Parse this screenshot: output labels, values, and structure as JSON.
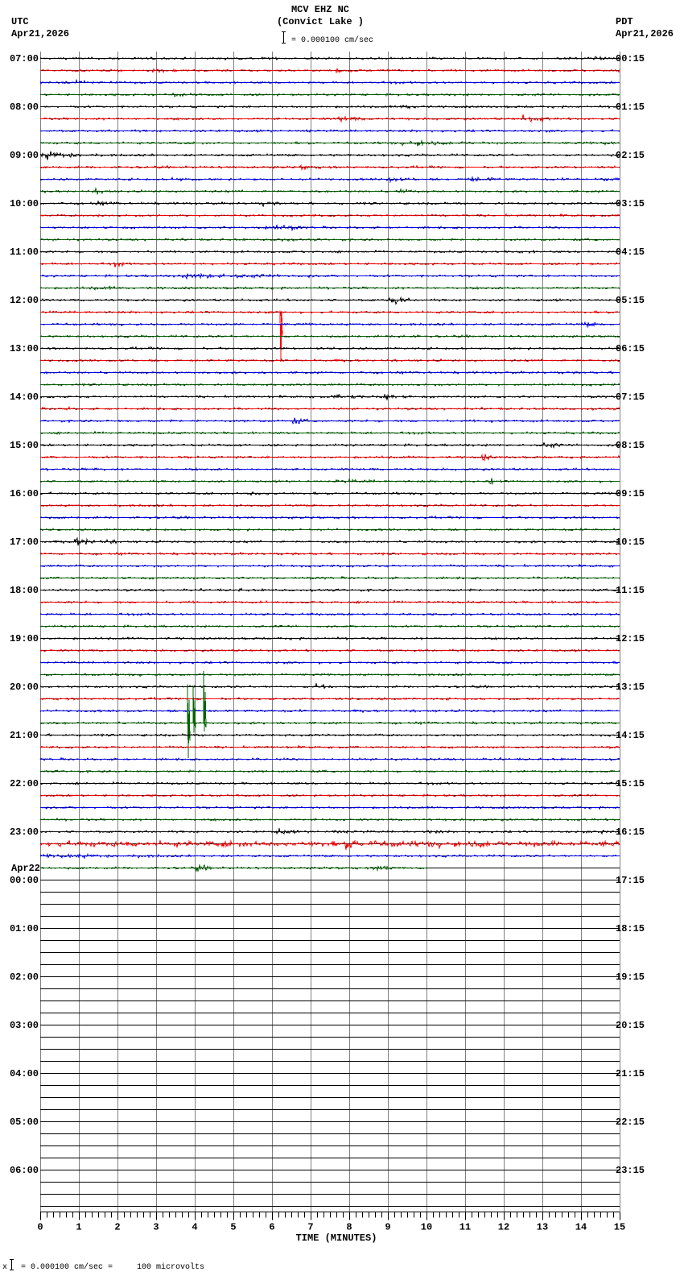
{
  "header": {
    "station": "MCV EHZ NC",
    "location": "(Convict Lake )",
    "left_zone": "UTC",
    "left_date": "Apr21,2026",
    "right_zone": "PDT",
    "right_date": "Apr21,2026",
    "scale_text": "= 0.000100 cm/sec"
  },
  "footer": {
    "prefix": "x",
    "scale_text": "= 0.000100 cm/sec =     100 microvolts"
  },
  "chart_data": {
    "type": "line",
    "title": "MCV EHZ NC (Convict Lake )",
    "xlabel": "TIME (MINUTES)",
    "x_ticks": [
      "0",
      "1",
      "2",
      "3",
      "4",
      "5",
      "6",
      "7",
      "8",
      "9",
      "10",
      "11",
      "12",
      "13",
      "14",
      "15"
    ],
    "xlim": [
      0,
      15
    ],
    "minutes_per_line": 15,
    "lines_per_hour": 4,
    "total_lines": 96,
    "recorded_lines": 68,
    "last_line_end_min": 10.0,
    "trace_colors": [
      "#000000",
      "#ff0000",
      "#0000ff",
      "#006400"
    ],
    "grid_color": "#808080",
    "amplitude_unit_cm_per_sec": 0.0001,
    "noise_level": 0.07,
    "left_labels": [
      "07:00",
      "08:00",
      "09:00",
      "10:00",
      "11:00",
      "12:00",
      "13:00",
      "14:00",
      "15:00",
      "16:00",
      "17:00",
      "18:00",
      "19:00",
      "20:00",
      "21:00",
      "22:00",
      "23:00",
      "00:00",
      "01:00",
      "02:00",
      "03:00",
      "04:00",
      "05:00",
      "06:00"
    ],
    "date_change_label": "Apr22",
    "right_labels": [
      "00:15",
      "01:15",
      "02:15",
      "03:15",
      "04:15",
      "05:15",
      "06:15",
      "07:15",
      "08:15",
      "09:15",
      "10:15",
      "11:15",
      "12:15",
      "13:15",
      "14:15",
      "15:15",
      "16:15",
      "17:15",
      "18:15",
      "19:15",
      "20:15",
      "21:15",
      "22:15",
      "23:15"
    ],
    "events": [
      {
        "line": 0,
        "t": 14.1,
        "dur": 0.6,
        "amp": 0.12
      },
      {
        "line": 1,
        "t": 2.9,
        "dur": 0.6,
        "amp": 0.15
      },
      {
        "line": 1,
        "t": 7.6,
        "dur": 0.7,
        "amp": 0.15
      },
      {
        "line": 1,
        "t": 14.6,
        "dur": 0.4,
        "amp": 0.12
      },
      {
        "line": 2,
        "t": 0.3,
        "dur": 2.0,
        "amp": 0.1
      },
      {
        "line": 3,
        "t": 3.3,
        "dur": 0.8,
        "amp": 0.15
      },
      {
        "line": 4,
        "t": 9.3,
        "dur": 0.8,
        "amp": 0.15
      },
      {
        "line": 5,
        "t": 7.6,
        "dur": 1.0,
        "amp": 0.22
      },
      {
        "line": 5,
        "t": 12.4,
        "dur": 0.9,
        "amp": 0.3
      },
      {
        "line": 6,
        "t": 6.8,
        "dur": 0.6,
        "amp": 0.1
      },
      {
        "line": 7,
        "t": 9.3,
        "dur": 2.2,
        "amp": 0.2
      },
      {
        "line": 7,
        "t": 14.5,
        "dur": 0.5,
        "amp": 0.15
      },
      {
        "line": 8,
        "t": 0.0,
        "dur": 1.5,
        "amp": 0.3
      },
      {
        "line": 9,
        "t": 6.7,
        "dur": 0.7,
        "amp": 0.15
      },
      {
        "line": 10,
        "t": 3.3,
        "dur": 0.8,
        "amp": 0.15
      },
      {
        "line": 10,
        "t": 8.8,
        "dur": 1.0,
        "amp": 0.2
      },
      {
        "line": 10,
        "t": 10.9,
        "dur": 1.2,
        "amp": 0.25
      },
      {
        "line": 10,
        "t": 14.5,
        "dur": 0.4,
        "amp": 0.2
      },
      {
        "line": 11,
        "t": 1.4,
        "dur": 0.5,
        "amp": 0.2
      },
      {
        "line": 11,
        "t": 9.2,
        "dur": 0.6,
        "amp": 0.15
      },
      {
        "line": 12,
        "t": 1.3,
        "dur": 0.7,
        "amp": 0.12
      },
      {
        "line": 12,
        "t": 5.7,
        "dur": 0.6,
        "amp": 0.12
      },
      {
        "line": 13,
        "t": 1.4,
        "dur": 0.3,
        "amp": 0.15
      },
      {
        "line": 14,
        "t": 5.8,
        "dur": 1.0,
        "amp": 0.3
      },
      {
        "line": 15,
        "t": 6.1,
        "dur": 0.4,
        "amp": 0.25
      },
      {
        "line": 16,
        "t": 12.3,
        "dur": 0.5,
        "amp": 0.15
      },
      {
        "line": 17,
        "t": 1.9,
        "dur": 0.4,
        "amp": 0.2
      },
      {
        "line": 18,
        "t": 3.5,
        "dur": 3.5,
        "amp": 0.18
      },
      {
        "line": 19,
        "t": 1.3,
        "dur": 0.8,
        "amp": 0.12
      },
      {
        "line": 20,
        "t": 9.0,
        "dur": 0.6,
        "amp": 0.45
      },
      {
        "line": 22,
        "t": 14.0,
        "dur": 0.6,
        "amp": 0.2
      },
      {
        "line": 23,
        "t": 9.2,
        "dur": 0.6,
        "amp": 0.18
      },
      {
        "line": 28,
        "t": 7.5,
        "dur": 2.2,
        "amp": 0.15
      },
      {
        "line": 28,
        "t": 8.9,
        "dur": 0.5,
        "amp": 0.25
      },
      {
        "line": 29,
        "t": 0.5,
        "dur": 0.3,
        "amp": 0.2
      },
      {
        "line": 30,
        "t": 6.5,
        "dur": 0.5,
        "amp": 0.25
      },
      {
        "line": 30,
        "t": 11.5,
        "dur": 0.3,
        "amp": 0.15
      },
      {
        "line": 32,
        "t": 13.0,
        "dur": 0.5,
        "amp": 0.3
      },
      {
        "line": 33,
        "t": 11.4,
        "dur": 0.4,
        "amp": 0.3
      },
      {
        "line": 34,
        "t": 1.4,
        "dur": 0.3,
        "amp": 0.2
      },
      {
        "line": 35,
        "t": 7.5,
        "dur": 1.5,
        "amp": 0.12
      },
      {
        "line": 35,
        "t": 11.6,
        "dur": 0.4,
        "amp": 0.22
      },
      {
        "line": 36,
        "t": 5.3,
        "dur": 1.2,
        "amp": 0.15
      },
      {
        "line": 40,
        "t": 0.8,
        "dur": 1.2,
        "amp": 0.3
      },
      {
        "line": 44,
        "t": 5.0,
        "dur": 0.5,
        "amp": 0.1
      },
      {
        "line": 52,
        "t": 7.1,
        "dur": 0.5,
        "amp": 0.25
      },
      {
        "line": 64,
        "t": 6.1,
        "dur": 0.6,
        "amp": 0.2
      },
      {
        "line": 64,
        "t": 7.5,
        "dur": 1.0,
        "amp": 0.15
      },
      {
        "line": 64,
        "t": 10.0,
        "dur": 0.5,
        "amp": 0.15
      },
      {
        "line": 64,
        "t": 14.5,
        "dur": 0.5,
        "amp": 0.3
      },
      {
        "line": 65,
        "t": 0.0,
        "dur": 15.0,
        "amp": 0.12
      },
      {
        "line": 65,
        "t": 7.8,
        "dur": 1.2,
        "amp": 0.25
      },
      {
        "line": 65,
        "t": 11.2,
        "dur": 0.6,
        "amp": 0.2
      },
      {
        "line": 66,
        "t": 0.0,
        "dur": 3.5,
        "amp": 0.12
      },
      {
        "line": 67,
        "t": 4.0,
        "dur": 0.5,
        "amp": 0.25
      },
      {
        "line": 67,
        "t": 8.6,
        "dur": 0.8,
        "amp": 0.2
      }
    ],
    "spikes": [
      {
        "line": 21,
        "t": 6.2,
        "up": 0.15,
        "down": 4.1
      },
      {
        "line": 55,
        "t": 3.81,
        "up": 3.2,
        "down": 2.9
      },
      {
        "line": 55,
        "t": 3.95,
        "up": 3.1,
        "down": 0.8
      },
      {
        "line": 55,
        "t": 4.23,
        "up": 4.3,
        "down": 0.7
      }
    ]
  }
}
